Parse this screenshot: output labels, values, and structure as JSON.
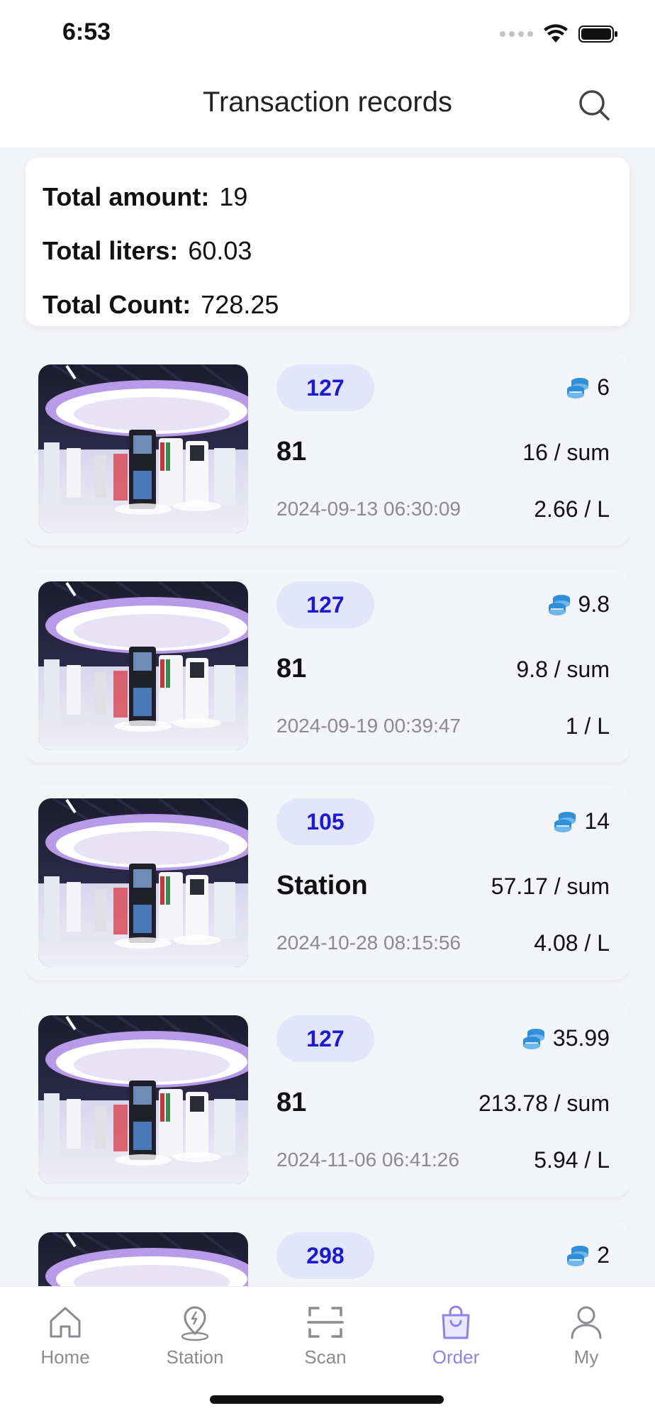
{
  "status_bar": {
    "time": "6:53"
  },
  "header": {
    "title": "Transaction records"
  },
  "summary": {
    "amount_label": "Total amount:",
    "amount_value": "19",
    "liters_label": "Total liters:",
    "liters_value": "60.03",
    "count_label": "Total Count:",
    "count_value": "728.25"
  },
  "records": [
    {
      "badge": "127",
      "coins": "6",
      "station": "81",
      "sum": "16 / sum",
      "date": "2024-09-13 06:30:09",
      "per_l": "2.66 / L"
    },
    {
      "badge": "127",
      "coins": "9.8",
      "station": "81",
      "sum": "9.8 / sum",
      "date": "2024-09-19 00:39:47",
      "per_l": "1 / L"
    },
    {
      "badge": "105",
      "coins": "14",
      "station": "Station",
      "sum": "57.17 / sum",
      "date": "2024-10-28 08:15:56",
      "per_l": "4.08 / L"
    },
    {
      "badge": "127",
      "coins": "35.99",
      "station": "81",
      "sum": "213.78 / sum",
      "date": "2024-11-06 06:41:26",
      "per_l": "5.94 / L"
    },
    {
      "badge": "298",
      "coins": "2",
      "station": "",
      "sum": "",
      "date": "",
      "per_l": ""
    }
  ],
  "tabbar": {
    "home": "Home",
    "station": "Station",
    "scan": "Scan",
    "order": "Order",
    "my": "My",
    "active": "order",
    "active_color": "#8b82f2",
    "inactive_color": "#8a8a8f"
  },
  "colors": {
    "badge_bg": "#e3e6fb",
    "badge_text": "#1a1ad6",
    "coin_icon": "#2f8fd8"
  },
  "icons": {
    "search": "search-icon",
    "coins": "coins-icon",
    "home": "home-icon",
    "station": "station-pin-icon",
    "scan": "scan-icon",
    "order": "shopping-bag-icon",
    "my": "user-icon"
  }
}
